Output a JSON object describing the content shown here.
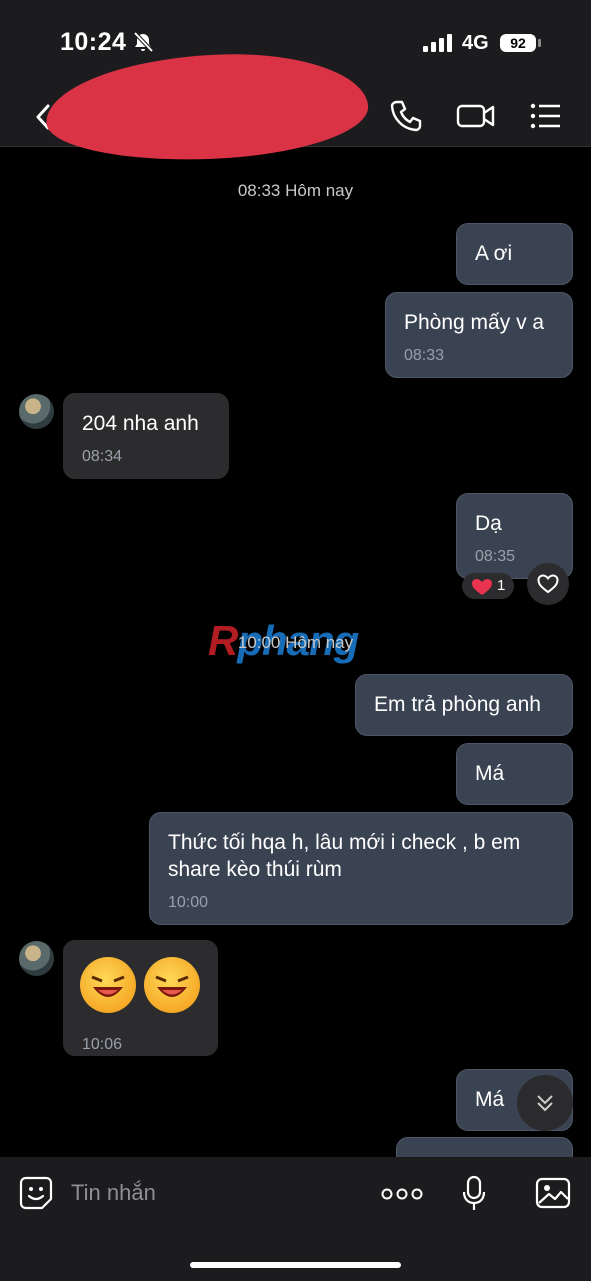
{
  "status_bar": {
    "time": "10:24",
    "network": "4G",
    "battery": "92"
  },
  "header": {
    "contact_name": ""
  },
  "watermark": {
    "part_a": "R",
    "part_b": "phang"
  },
  "messages": [
    {
      "type": "timestamp",
      "text": "08:33 Hôm nay"
    },
    {
      "type": "out",
      "text": "A ơi"
    },
    {
      "type": "out",
      "text": "Phòng mấy v a",
      "time": "08:33"
    },
    {
      "type": "in",
      "text": "204 nha anh",
      "time": "08:34"
    },
    {
      "type": "out",
      "text": "Dạ",
      "time": "08:35",
      "reaction": {
        "emoji": "heart",
        "count": "1"
      }
    },
    {
      "type": "timestamp",
      "text": "10:00 Hôm nay"
    },
    {
      "type": "out",
      "text": "Em trả phòng anh"
    },
    {
      "type": "out",
      "text": "Má"
    },
    {
      "type": "out",
      "text": "Thức tối hqa h, lâu mới i check , b em share kèo thúi rùm",
      "time": "10:00"
    },
    {
      "type": "in",
      "emoji": "laughing-face x2",
      "time": "10:06"
    },
    {
      "type": "out",
      "text": "Má"
    }
  ],
  "composer": {
    "placeholder": "Tin nhắn"
  },
  "colors": {
    "outgoing_bubble": "#3a4352",
    "incoming_bubble": "#2c2c2e",
    "redaction": "#d93345",
    "heart": "#e8344e"
  }
}
